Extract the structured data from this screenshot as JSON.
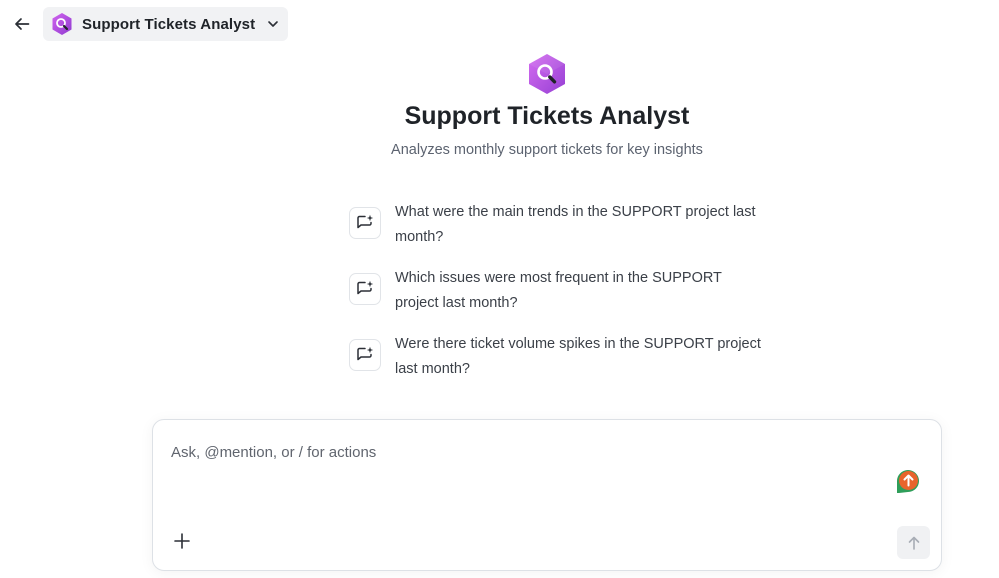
{
  "header": {
    "agent_name": "Support Tickets Analyst"
  },
  "hero": {
    "title": "Support Tickets Analyst",
    "subtitle": "Analyzes monthly support tickets for key insights"
  },
  "suggestions": [
    {
      "text": "What were the main trends in the SUPPORT project last month?"
    },
    {
      "text": "Which issues were most frequent in the SUPPORT project last month?"
    },
    {
      "text": "Were there ticket volume spikes in the SUPPORT project last month?"
    }
  ],
  "composer": {
    "placeholder": "Ask, @mention, or / for actions",
    "value": ""
  },
  "icons": {
    "back": "arrow-left-icon",
    "agent": "hexagon-search-icon",
    "switcher": "chevron-down-icon",
    "suggestion": "chat-sparkle-icon",
    "assist": "upload-assist-icon",
    "add": "plus-icon",
    "send": "arrow-up-icon"
  },
  "colors": {
    "agent_gradient_start": "#d163ee",
    "agent_gradient_end": "#8f3bd0",
    "assist_orange": "#e8642c",
    "assist_green": "#2f9e5a"
  }
}
